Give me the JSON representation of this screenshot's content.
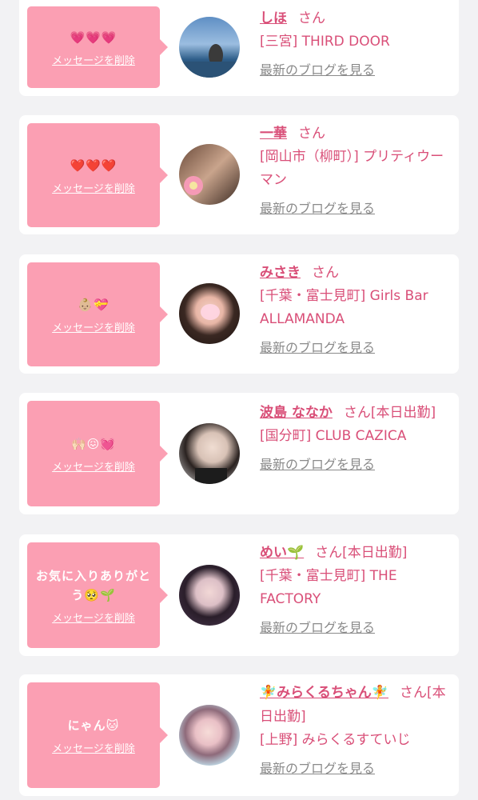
{
  "delete_label": "メッセージを削除",
  "san_label": "さん",
  "blog_label": "最新のブログを見る",
  "cards": [
    {
      "message": "💗💗💗",
      "name": "しほ",
      "suffix": "",
      "shop": "[三宮] THIRD DOOR"
    },
    {
      "message": "❤️❤️❤️",
      "name": "一華",
      "suffix": "",
      "shop": "[岡山市（柳町）] プリティウーマン"
    },
    {
      "message": "👶🏼💝",
      "name": "みさき",
      "suffix": "",
      "shop": "[千葉・富士見町] Girls Bar ALLAMANDA"
    },
    {
      "message": "🙌🏻😖💓",
      "name": "波島 ななか",
      "suffix": "[本日出勤]",
      "shop": "[国分町] CLUB CAZICA"
    },
    {
      "message": "お気に入りありがとう🥺🌱",
      "name": "めい🌱",
      "suffix": "[本日出勤]",
      "shop": "[千葉・富士見町] THE FACTORY"
    },
    {
      "message": "にゃん🐱",
      "name": "🧚みらくるちゃん🧚",
      "suffix": "[本日出勤]",
      "shop": "[上野] みらくるすていじ"
    }
  ]
}
